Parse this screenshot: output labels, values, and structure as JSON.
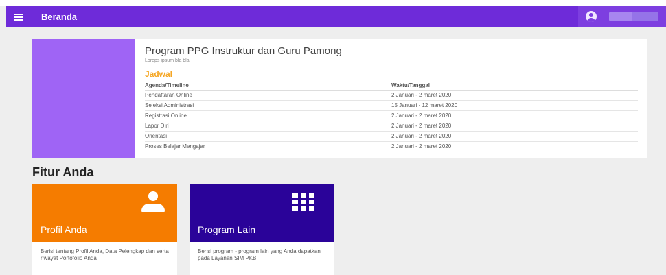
{
  "header": {
    "menu_icon": "hamburger-menu-icon",
    "title": "Beranda",
    "user_avatar_icon": "user-avatar-icon"
  },
  "program": {
    "title": "Program PPG Instruktur dan Guru Pamong",
    "subtitle": "Loreps ipsum bla bla",
    "schedule_heading": "Jadwal",
    "columns": [
      "Agenda/Timeline",
      "Waktu/Tanggal"
    ],
    "rows": [
      [
        "Pendaftaran Online",
        "2 Januari - 2 maret 2020"
      ],
      [
        "Seleksi Administrasi",
        "15 Januari - 12 maret 2020"
      ],
      [
        "Registrasi Online",
        "2 Januari - 2 maret 2020"
      ],
      [
        "Lapor Diri",
        "2 Januari - 2 maret 2020"
      ],
      [
        "Orientasi",
        "2 Januari - 2 maret 2020"
      ],
      [
        "Proses Belajar Mengajar",
        "2 Januari - 2 maret 2020"
      ]
    ]
  },
  "features": {
    "heading": "Fitur Anda",
    "cards": [
      {
        "title": "Profil Anda",
        "icon": "person-icon",
        "description": "Berisi tentang Profil Anda, Data Pelengkap dan serta riwayat Portofolio Anda"
      },
      {
        "title": "Program Lain",
        "icon": "apps-grid-icon",
        "description": "Berisi program - program lain yang Anda dapatkan pada Layanan SIM PKB"
      }
    ]
  },
  "colors": {
    "topbar": "#6e2bd9",
    "accent_side": "#9f64f5",
    "schedule_heading": "#f5a623",
    "card_profil": "#f57c00",
    "card_program": "#2a0399"
  }
}
